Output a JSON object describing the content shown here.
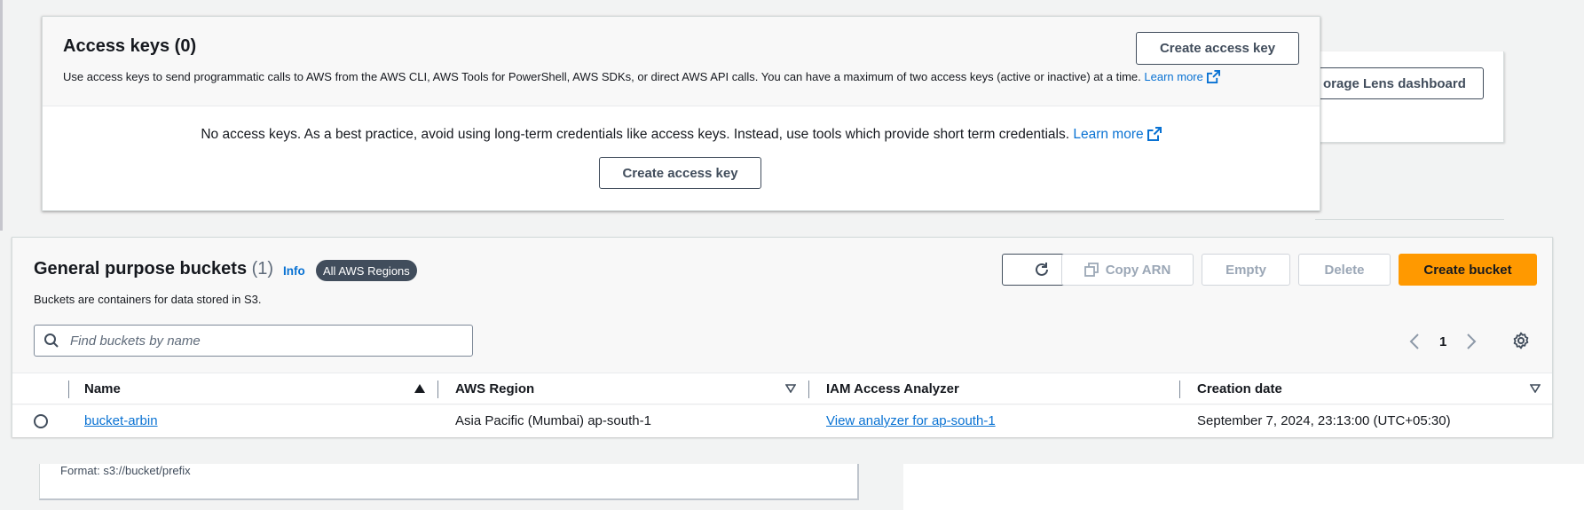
{
  "access_keys": {
    "title": "Access keys (0)",
    "description": "Use access keys to send programmatic calls to AWS from the AWS CLI, AWS Tools for PowerShell, AWS SDKs, or direct AWS API calls. You can have a maximum of two access keys (active or inactive) at a time.",
    "learn_more": "Learn more",
    "create_button": "Create access key",
    "empty_message": "No access keys. As a best practice, avoid using long-term credentials like access keys. Instead, use tools which provide short term credentials.",
    "empty_learn_more": "Learn more",
    "empty_create_button": "Create access key"
  },
  "storage_lens": {
    "button_label": "orage Lens dashboard"
  },
  "buckets": {
    "title": "General purpose buckets",
    "count": "(1)",
    "info": "Info",
    "region_badge": "All AWS Regions",
    "description": "Buckets are containers for data stored in S3.",
    "actions": {
      "copy_arn": "Copy ARN",
      "empty": "Empty",
      "delete": "Delete",
      "create": "Create bucket"
    },
    "search_placeholder": "Find buckets by name",
    "page": "1",
    "columns": [
      "Name",
      "AWS Region",
      "IAM Access Analyzer",
      "Creation date"
    ],
    "rows": [
      {
        "name": "bucket-arbin",
        "region": "Asia Pacific (Mumbai) ap-south-1",
        "analyzer": "View analyzer for ap-south-1",
        "created": "September 7, 2024, 23:13:00 (UTC+05:30)"
      }
    ]
  },
  "lower": {
    "format_hint": "Format: s3://bucket/prefix"
  },
  "colors": {
    "link": "#0972d3",
    "primary_button": "#ff9900",
    "badge": "#414d5c"
  }
}
